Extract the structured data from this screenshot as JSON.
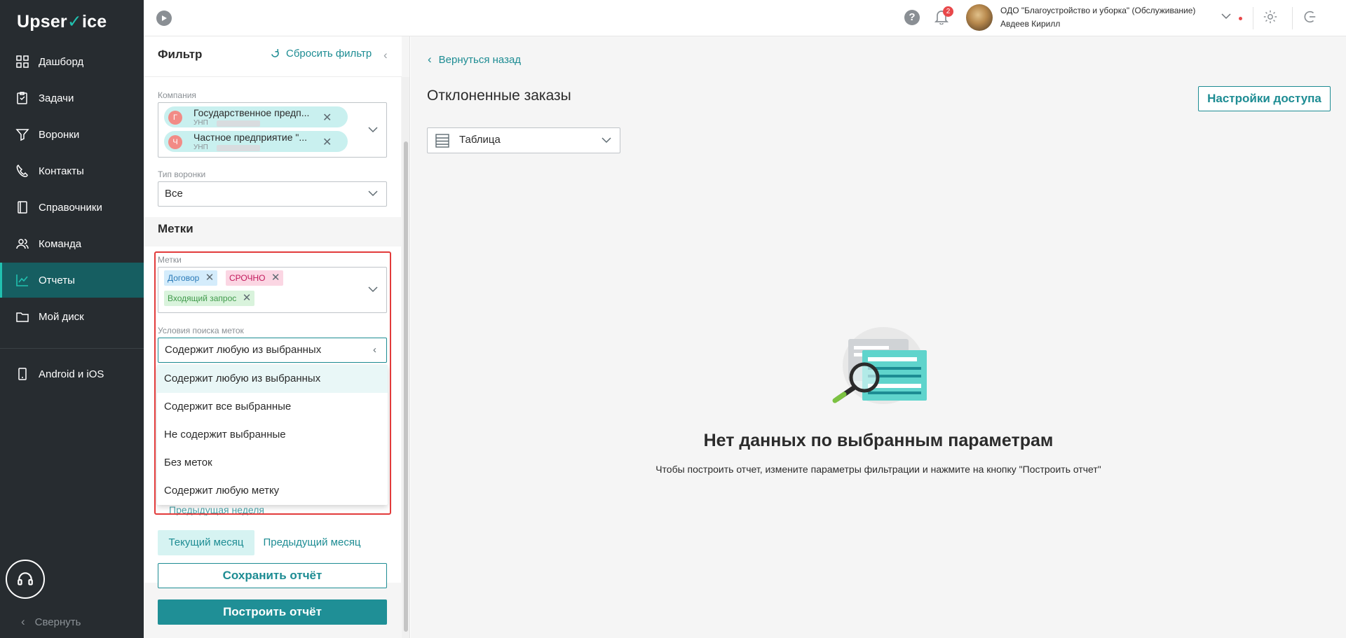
{
  "app": {
    "logo_prefix": "Upser",
    "logo_tick": "✓",
    "logo_suffix": "ice"
  },
  "sidebar": {
    "items": [
      {
        "label": "Дашборд",
        "icon": "dashboard-icon"
      },
      {
        "label": "Задачи",
        "icon": "tasks-icon"
      },
      {
        "label": "Воронки",
        "icon": "funnel-icon"
      },
      {
        "label": "Контакты",
        "icon": "contacts-icon"
      },
      {
        "label": "Справочники",
        "icon": "book-icon"
      },
      {
        "label": "Команда",
        "icon": "team-icon"
      },
      {
        "label": "Отчеты",
        "icon": "reports-icon",
        "active": true
      },
      {
        "label": "Мой диск",
        "icon": "folder-icon"
      },
      {
        "label": "Android и iOS",
        "icon": "phone-icon"
      }
    ],
    "collapse_label": "Свернуть"
  },
  "topbar": {
    "notifications_count": "2",
    "company_name": "ОДО \"Благоустройство и уборка\" (Обслуживание)",
    "user_name": "Авдеев Кирилл"
  },
  "filter": {
    "title": "Фильтр",
    "reset_label": "Сбросить фильтр",
    "company_label": "Компания",
    "companies": [
      {
        "initial": "Г",
        "name": "Государственное предп...",
        "unp_label": "УНП"
      },
      {
        "initial": "Ч",
        "name": "Частное предприятие \"...",
        "unp_label": "УНП"
      }
    ],
    "funnel_type_label": "Тип воронки",
    "funnel_type_value": "Все",
    "tags_section_title": "Метки",
    "tags_label": "Метки",
    "tags": [
      {
        "label": "Договор",
        "bg": "#d4ecfb",
        "color": "#2a7ab8"
      },
      {
        "label": "СРОЧНО",
        "bg": "#fbd6e3",
        "color": "#c2185b"
      },
      {
        "label": "Входящий запрос",
        "bg": "#d9f3dc",
        "color": "#3f9a4a"
      }
    ],
    "condition_label": "Условия поиска меток",
    "condition_value": "Содержит любую из выбранных",
    "condition_options": [
      "Содержит любую из выбранных",
      "Содержит все выбранные",
      "Не содержит выбранные",
      "Без меток",
      "Содержит любую метку"
    ],
    "prev_week_label": "Предыдущая неделя",
    "current_month_label": "Текущий месяц",
    "prev_month_label": "Предыдущий месяц",
    "save_label": "Сохранить отчёт",
    "build_label": "Построить отчёт"
  },
  "main": {
    "back_label": "Вернуться назад",
    "title": "Отклоненные заказы",
    "access_label": "Настройки доступа",
    "view_value": "Таблица",
    "empty_title": "Нет данных по выбранным параметрам",
    "empty_subtitle": "Чтобы построить отчет, измените параметры фильтрации и нажмите на кнопку \"Построить отчет\""
  },
  "colors": {
    "accent": "#1d8c93",
    "sidebar_bg": "#272c30",
    "highlight": "#e23b3b"
  }
}
